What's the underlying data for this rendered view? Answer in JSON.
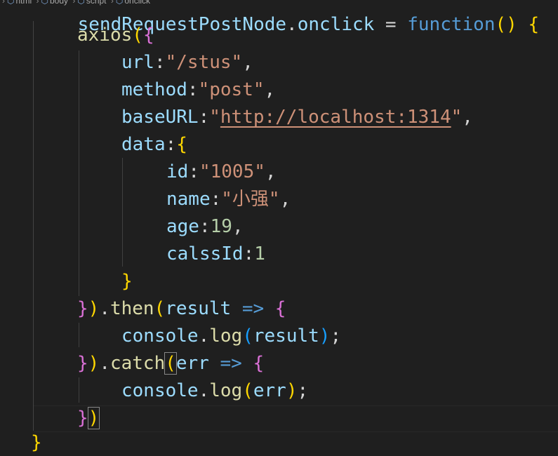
{
  "breadcrumb": {
    "items": [
      "html",
      "body",
      "script",
      "onclick"
    ]
  },
  "sticky_line": {
    "var": "sendRequestPostNode",
    "prop": "onclick",
    "op": " = ",
    "kw": "function",
    "rest": "() {"
  },
  "code": {
    "l1_fn": "axios",
    "l1_open": "(",
    "l1_brace": "{",
    "url_key": "url",
    "url_val": "\"/stus\"",
    "method_key": "method",
    "method_val": "\"post\"",
    "base_key": "baseURL",
    "base_q1": "\"",
    "base_val": "http://localhost:1314",
    "base_q2": "\"",
    "data_key": "data",
    "data_brace": "{",
    "id_key": "id",
    "id_val": "\"1005\"",
    "name_key": "name",
    "name_val": "\"小强\"",
    "age_key": "age",
    "age_val": "19",
    "cls_key": "calssId",
    "cls_val": "1",
    "data_close": "}",
    "then_close_b": "}",
    "then_close_p": ")",
    "then_fn": "then",
    "then_open": "(",
    "then_param": "result",
    "arrow": " => ",
    "then_brace": "{",
    "log1_obj": "console",
    "log1_fn": "log",
    "log1_open": "(",
    "log1_arg": "result",
    "log1_close": ")",
    "catch_close_b": "}",
    "catch_close_p": ")",
    "catch_fn": "catch",
    "catch_open": "(",
    "catch_param": "err",
    "catch_brace": "{",
    "log2_obj": "console",
    "log2_fn": "log",
    "log2_open": "(",
    "log2_arg": "err",
    "log2_close": ")",
    "end_b": "}",
    "end_p": ")",
    "outer_close": "}"
  },
  "colors": {
    "background": "#1f1f1f",
    "variable": "#9cdcfe",
    "function": "#dcdcaa",
    "keyword": "#569cd6",
    "string": "#ce9178",
    "number": "#b5cea8",
    "bracket_level1": "#da70d6",
    "bracket_level2": "#ffd700",
    "bracket_level3": "#179fff"
  }
}
